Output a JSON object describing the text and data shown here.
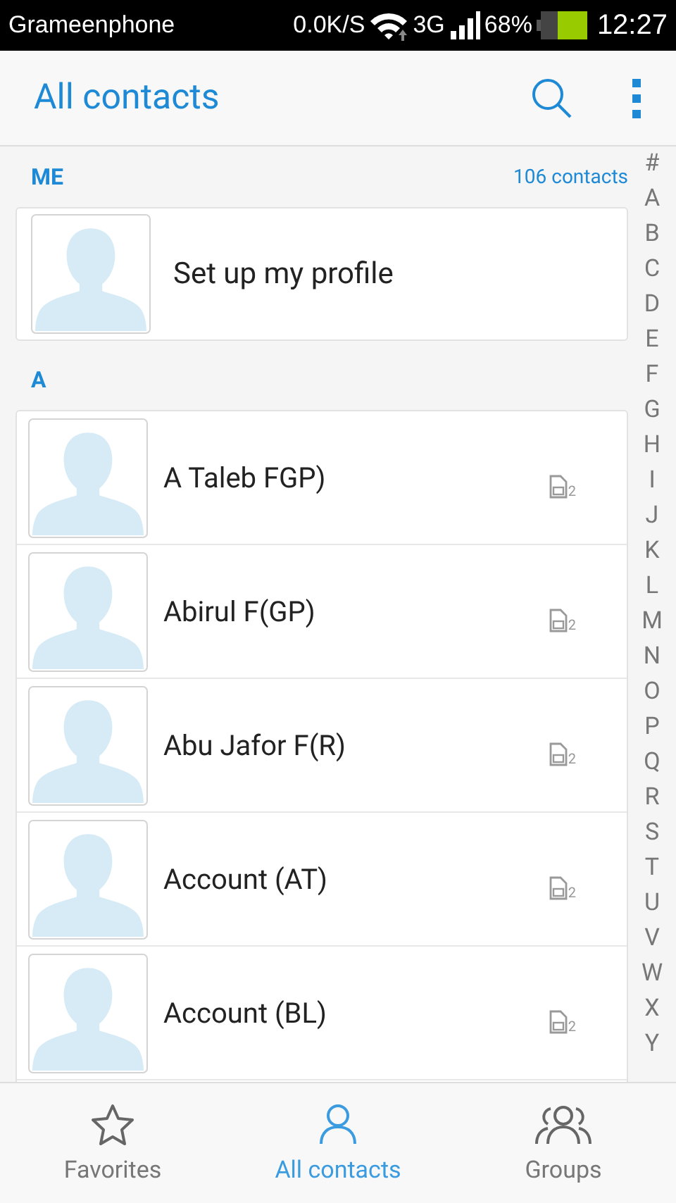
{
  "status_bar": {
    "carrier": "Grameenphone",
    "speed": "0.0K/S",
    "network": "3G",
    "battery": "68%",
    "time": "12:27"
  },
  "header": {
    "title": "All contacts"
  },
  "me_section": {
    "label": "ME",
    "count": "106 contacts",
    "profile": "Set up my profile"
  },
  "sections": [
    {
      "label": "A",
      "contacts": [
        {
          "name": "A Taleb FGP)",
          "sim": "2"
        },
        {
          "name": "Abirul F(GP)",
          "sim": "2"
        },
        {
          "name": "Abu Jafor F(R)",
          "sim": "2"
        },
        {
          "name": "Account (AT)",
          "sim": "2"
        },
        {
          "name": "Account (BL)",
          "sim": "2"
        }
      ]
    }
  ],
  "index": [
    "#",
    "A",
    "B",
    "C",
    "D",
    "E",
    "F",
    "G",
    "H",
    "I",
    "J",
    "K",
    "L",
    "M",
    "N",
    "O",
    "P",
    "Q",
    "R",
    "S",
    "T",
    "U",
    "V",
    "W",
    "X",
    "Y"
  ],
  "tabs": [
    {
      "label": "Favorites",
      "kind": "star",
      "selected": false
    },
    {
      "label": "All contacts",
      "kind": "person",
      "selected": true
    },
    {
      "label": "Groups",
      "kind": "group",
      "selected": false
    }
  ]
}
